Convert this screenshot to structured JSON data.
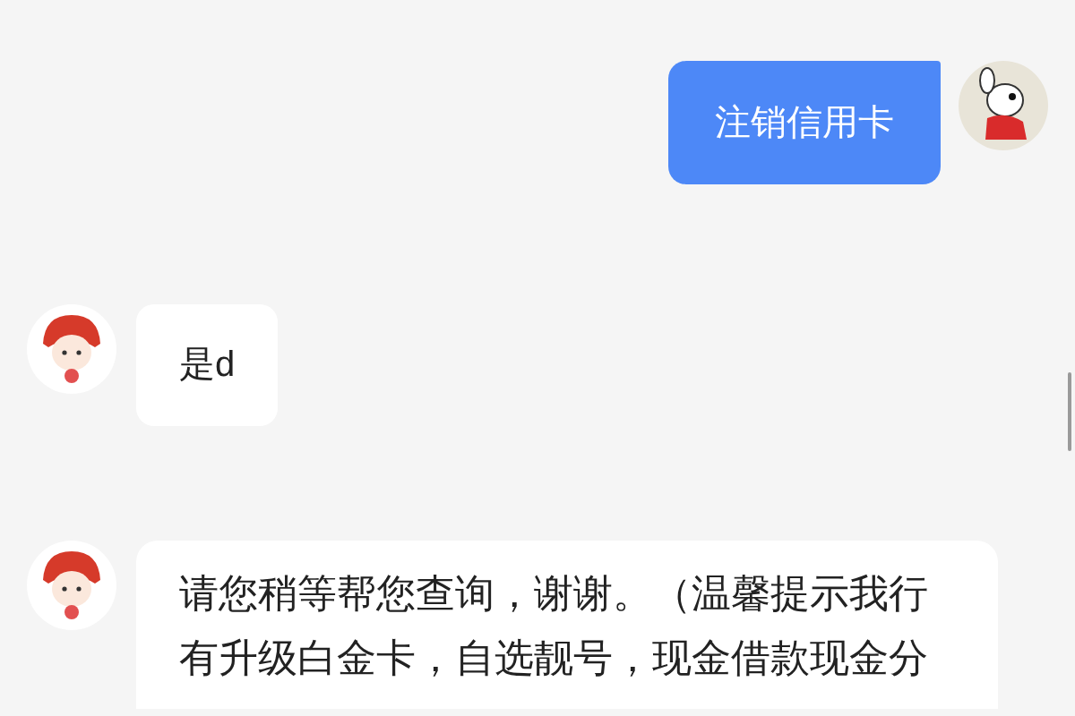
{
  "messages": [
    {
      "kind": "outgoing",
      "text": "注销信用卡"
    },
    {
      "kind": "incoming",
      "text": "是d"
    },
    {
      "kind": "incoming",
      "text": "请您稍等帮您查询，谢谢。（温馨提示我行有升级白金卡，自选靓号，现金借款现金分"
    }
  ]
}
